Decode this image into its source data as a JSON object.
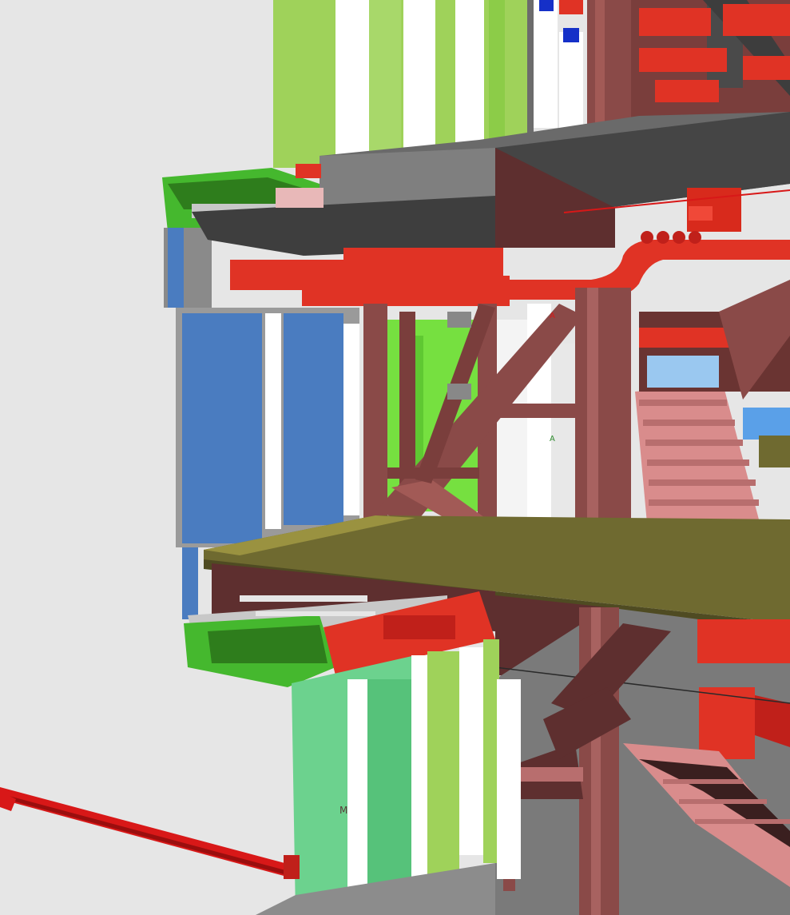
{
  "viewport": {
    "background": "#e6e6e6"
  },
  "labels": {
    "glass_marker": "M",
    "brace_marker_red": "A",
    "brace_marker_green": "A"
  },
  "materials": {
    "structural_steel": "#8a4a48",
    "steel_dark": "#5e2f2f",
    "duct_red": "#e03325",
    "floor_slab": "#6f6a30",
    "curtain_wall_green": "#9fd25a",
    "glass_blue": "#4a7cc0",
    "mep_green": "#45b82e",
    "ceiling_grey": "#5a5a5a",
    "glass_light_green": "#6cd28e"
  }
}
